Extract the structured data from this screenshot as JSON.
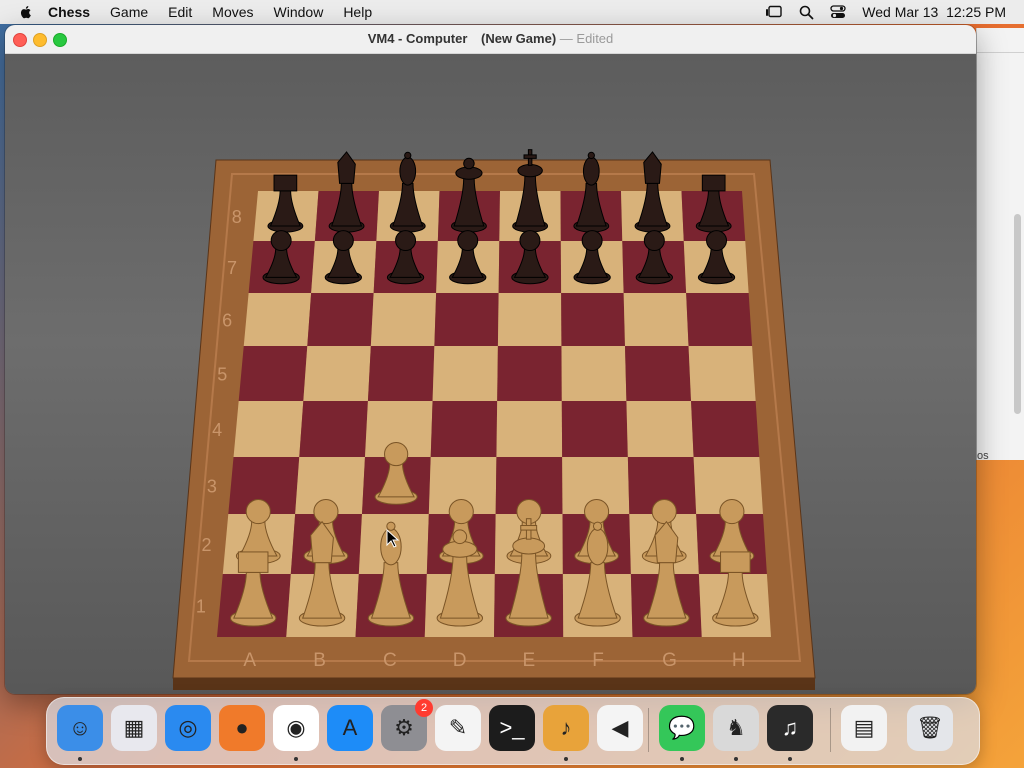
{
  "menubar": {
    "app_name": "Chess",
    "items": [
      "Game",
      "Edit",
      "Moves",
      "Window",
      "Help"
    ],
    "datetime": "Wed Mar 13  12:25 PM"
  },
  "window": {
    "title": "VM4 - Computer",
    "subtitle": "(New Game)",
    "separator": "—",
    "status": "Edited"
  },
  "board": {
    "files": [
      "A",
      "B",
      "C",
      "D",
      "E",
      "F",
      "G",
      "H"
    ],
    "ranks": [
      "1",
      "2",
      "3",
      "4",
      "5",
      "6",
      "7",
      "8"
    ],
    "light_square": "#d8b27a",
    "dark_square": "#7a2430",
    "frame_color": "#9c6436",
    "white_piece_color": "#c89a5c",
    "black_piece_color": "#2a1a16",
    "pieces": [
      {
        "color": "black",
        "type": "rook",
        "square": "a8"
      },
      {
        "color": "black",
        "type": "knight",
        "square": "b8"
      },
      {
        "color": "black",
        "type": "bishop",
        "square": "c8"
      },
      {
        "color": "black",
        "type": "queen",
        "square": "d8"
      },
      {
        "color": "black",
        "type": "king",
        "square": "e8"
      },
      {
        "color": "black",
        "type": "bishop",
        "square": "f8"
      },
      {
        "color": "black",
        "type": "knight",
        "square": "g8"
      },
      {
        "color": "black",
        "type": "rook",
        "square": "h8"
      },
      {
        "color": "black",
        "type": "pawn",
        "square": "a7"
      },
      {
        "color": "black",
        "type": "pawn",
        "square": "b7"
      },
      {
        "color": "black",
        "type": "pawn",
        "square": "c7"
      },
      {
        "color": "black",
        "type": "pawn",
        "square": "d7"
      },
      {
        "color": "black",
        "type": "pawn",
        "square": "e7"
      },
      {
        "color": "black",
        "type": "pawn",
        "square": "f7"
      },
      {
        "color": "black",
        "type": "pawn",
        "square": "g7"
      },
      {
        "color": "black",
        "type": "pawn",
        "square": "h7"
      },
      {
        "color": "white",
        "type": "pawn",
        "square": "a2"
      },
      {
        "color": "white",
        "type": "pawn",
        "square": "b2"
      },
      {
        "color": "white",
        "type": "pawn",
        "square": "c3"
      },
      {
        "color": "white",
        "type": "pawn",
        "square": "d2"
      },
      {
        "color": "white",
        "type": "pawn",
        "square": "e2"
      },
      {
        "color": "white",
        "type": "pawn",
        "square": "f2"
      },
      {
        "color": "white",
        "type": "pawn",
        "square": "g2"
      },
      {
        "color": "white",
        "type": "pawn",
        "square": "h2"
      },
      {
        "color": "white",
        "type": "rook",
        "square": "a1"
      },
      {
        "color": "white",
        "type": "knight",
        "square": "b1"
      },
      {
        "color": "white",
        "type": "bishop",
        "square": "c1"
      },
      {
        "color": "white",
        "type": "queen",
        "square": "d1"
      },
      {
        "color": "white",
        "type": "king",
        "square": "e1"
      },
      {
        "color": "white",
        "type": "bishop",
        "square": "f1"
      },
      {
        "color": "white",
        "type": "knight",
        "square": "g1"
      },
      {
        "color": "white",
        "type": "rook",
        "square": "h1"
      }
    ]
  },
  "background_window": {
    "fragment_text": "os"
  },
  "dock": {
    "items": [
      {
        "name": "Finder",
        "icon": "finder-icon",
        "running": true
      },
      {
        "name": "Launchpad",
        "icon": "launchpad-icon",
        "running": false
      },
      {
        "name": "Safari",
        "icon": "safari-icon",
        "running": false
      },
      {
        "name": "Firefox",
        "icon": "firefox-icon",
        "running": false
      },
      {
        "name": "Google Chrome",
        "icon": "chrome-icon",
        "running": true
      },
      {
        "name": "App Store",
        "icon": "app-store-icon",
        "running": false
      },
      {
        "name": "System Settings",
        "icon": "system-settings-icon",
        "running": false,
        "badge": "2"
      },
      {
        "name": "TextEdit",
        "icon": "textedit-icon",
        "running": false
      },
      {
        "name": "Terminal",
        "icon": "terminal-icon",
        "running": false
      },
      {
        "name": "GarageBand",
        "icon": "garageband-icon",
        "running": true
      },
      {
        "name": "Visual Studio Code",
        "icon": "vscode-icon",
        "running": false
      },
      {
        "name": "Messages",
        "icon": "messages-icon",
        "running": true
      },
      {
        "name": "Chess",
        "icon": "chess-icon",
        "running": true
      },
      {
        "name": "Piano",
        "icon": "piano-icon",
        "running": true
      },
      {
        "name": "Downloads",
        "icon": "downloads-stack-icon",
        "running": false
      },
      {
        "name": "Trash",
        "icon": "trash-icon",
        "running": false
      }
    ]
  }
}
